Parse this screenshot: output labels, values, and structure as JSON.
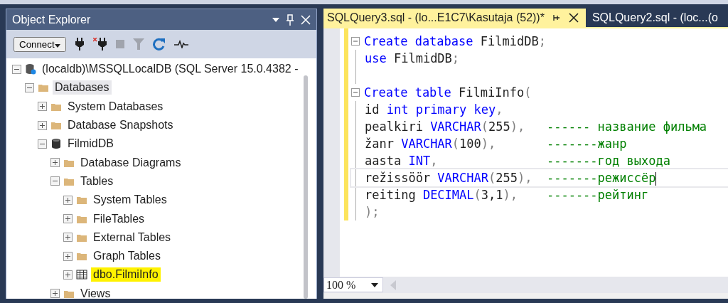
{
  "object_explorer": {
    "title": "Object Explorer",
    "toolbar": {
      "connect": "Connect"
    },
    "tree": [
      {
        "label": "(localdb)\\MSSQLLocalDB (SQL Server 15.0.4382 -",
        "kind": "server",
        "expanded": true,
        "selected": false,
        "highlighted": false,
        "children": [
          {
            "label": "Databases",
            "kind": "folder",
            "expanded": true,
            "selected": true,
            "highlighted": false,
            "children": [
              {
                "label": "System Databases",
                "kind": "folder",
                "expanded": false,
                "selected": false,
                "highlighted": false
              },
              {
                "label": "Database Snapshots",
                "kind": "folder",
                "expanded": false,
                "selected": false,
                "highlighted": false
              },
              {
                "label": "FilmidDB",
                "kind": "database",
                "expanded": true,
                "selected": false,
                "highlighted": false,
                "children": [
                  {
                    "label": "Database Diagrams",
                    "kind": "folder",
                    "expanded": false,
                    "selected": false,
                    "highlighted": false
                  },
                  {
                    "label": "Tables",
                    "kind": "folder",
                    "expanded": true,
                    "selected": false,
                    "highlighted": false,
                    "children": [
                      {
                        "label": "System Tables",
                        "kind": "folder",
                        "expanded": false,
                        "selected": false,
                        "highlighted": false
                      },
                      {
                        "label": "FileTables",
                        "kind": "folder",
                        "expanded": false,
                        "selected": false,
                        "highlighted": false
                      },
                      {
                        "label": "External Tables",
                        "kind": "folder",
                        "expanded": false,
                        "selected": false,
                        "highlighted": false
                      },
                      {
                        "label": "Graph Tables",
                        "kind": "folder",
                        "expanded": false,
                        "selected": false,
                        "highlighted": false
                      },
                      {
                        "label": "dbo.FilmiInfo",
                        "kind": "table",
                        "expanded": false,
                        "selected": false,
                        "highlighted": true
                      }
                    ]
                  },
                  {
                    "label": "Views",
                    "kind": "folder",
                    "expanded": false,
                    "selected": false,
                    "highlighted": false
                  }
                ]
              }
            ]
          }
        ]
      }
    ]
  },
  "editor": {
    "tabs": [
      {
        "label": "SQLQuery3.sql - (lo...E1C7\\Kasutaja (52))*",
        "selected": true
      },
      {
        "label": "SQLQuery2.sql - (loc...(o",
        "selected": false
      }
    ],
    "lines": [
      {
        "fold": true,
        "current": false,
        "tokens": [
          {
            "kind": "keyword",
            "text": "Create database "
          },
          {
            "kind": "plain",
            "text": "FilmidDB"
          },
          {
            "kind": "punct",
            "text": ";"
          }
        ]
      },
      {
        "fold": false,
        "current": false,
        "tokens": [
          {
            "kind": "keyword",
            "text": "use "
          },
          {
            "kind": "plain",
            "text": "FilmidDB"
          },
          {
            "kind": "punct",
            "text": ";"
          }
        ]
      },
      {
        "fold": false,
        "current": false
      },
      {
        "fold": true,
        "current": false,
        "tokens": [
          {
            "kind": "keyword",
            "text": "Create table "
          },
          {
            "kind": "plain",
            "text": "FilmiInfo"
          },
          {
            "kind": "punct",
            "text": "("
          }
        ]
      },
      {
        "fold": false,
        "current": false,
        "tokens": [
          {
            "kind": "plain",
            "text": "id "
          },
          {
            "kind": "keyword",
            "text": "int primary key"
          },
          {
            "kind": "punct",
            "text": ","
          }
        ]
      },
      {
        "fold": false,
        "current": false,
        "tokens": [
          {
            "kind": "plain",
            "text": "pealkiri "
          },
          {
            "kind": "keyword",
            "text": "VARCHAR"
          },
          {
            "kind": "punct",
            "text": "("
          },
          {
            "kind": "plain",
            "text": "255"
          },
          {
            "kind": "punct",
            "text": "),   "
          },
          {
            "kind": "comment",
            "text": "------ название фильма"
          }
        ]
      },
      {
        "fold": false,
        "current": false,
        "tokens": [
          {
            "kind": "plain",
            "text": "žanr "
          },
          {
            "kind": "keyword",
            "text": "VARCHAR"
          },
          {
            "kind": "punct",
            "text": "("
          },
          {
            "kind": "plain",
            "text": "100"
          },
          {
            "kind": "punct",
            "text": "),       "
          },
          {
            "kind": "comment",
            "text": "-------жанр"
          }
        ]
      },
      {
        "fold": false,
        "current": false,
        "tokens": [
          {
            "kind": "plain",
            "text": "aasta "
          },
          {
            "kind": "keyword",
            "text": "INT"
          },
          {
            "kind": "punct",
            "text": ",               "
          },
          {
            "kind": "comment",
            "text": "-------год выхода"
          }
        ]
      },
      {
        "fold": false,
        "current": true,
        "tokens": [
          {
            "kind": "plain",
            "text": "režissöör "
          },
          {
            "kind": "keyword",
            "text": "VARCHAR"
          },
          {
            "kind": "punct",
            "text": "("
          },
          {
            "kind": "plain",
            "text": "255"
          },
          {
            "kind": "punct",
            "text": "),  "
          },
          {
            "kind": "comment",
            "text": "-------режиссёр"
          }
        ]
      },
      {
        "fold": false,
        "current": false,
        "tokens": [
          {
            "kind": "plain",
            "text": "reiting "
          },
          {
            "kind": "keyword",
            "text": "DECIMAL"
          },
          {
            "kind": "punct",
            "text": "("
          },
          {
            "kind": "plain",
            "text": "3,1"
          },
          {
            "kind": "punct",
            "text": "),    "
          },
          {
            "kind": "comment",
            "text": "-------рейтинг"
          }
        ]
      },
      {
        "fold": false,
        "current": false,
        "tokens": [
          {
            "kind": "punct",
            "text": ");"
          }
        ]
      }
    ],
    "zoom": "100 %"
  }
}
